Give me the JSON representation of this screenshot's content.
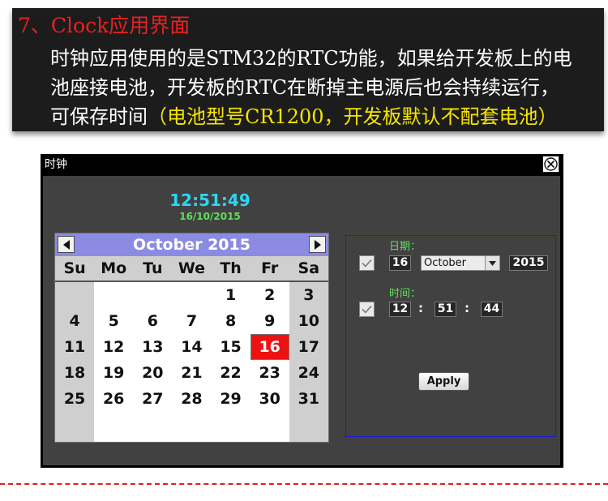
{
  "banner": {
    "title": "7、Clock应用界面",
    "line1": "时钟应用使用的是STM32的RTC功能，如果给开发板上的电",
    "line2": "池座接电池，开发板的RTC在断掉主电源后也会持续运行，",
    "line3_plain": "可保存时间",
    "line3_highlight": "（电池型号CR1200，开发板默认不配套电池）"
  },
  "window": {
    "title": "时钟",
    "close_icon": "close-x-icon"
  },
  "clock": {
    "time": "12:51:49",
    "date": "16/10/2015"
  },
  "calendar": {
    "month_label": "October 2015",
    "prev_icon": "left-triangle-icon",
    "next_icon": "right-triangle-icon",
    "weekdays": [
      "Su",
      "Mo",
      "Tu",
      "We",
      "Th",
      "Fr",
      "Sa"
    ],
    "days": [
      "1",
      "2",
      "3",
      "4",
      "5",
      "6",
      "7",
      "8",
      "9",
      "10",
      "11",
      "12",
      "13",
      "14",
      "15",
      "16",
      "17",
      "18",
      "19",
      "20",
      "21",
      "22",
      "23",
      "24",
      "25",
      "26",
      "27",
      "28",
      "29",
      "30",
      "31"
    ],
    "selected_day": "16",
    "colors": {
      "header": "#8b8be4",
      "selected": "#ee1111",
      "weekend": "#cfcfcf"
    }
  },
  "settings": {
    "date_label": "日期：",
    "time_label": "时间：",
    "day": "16",
    "month": "October",
    "year": "2015",
    "hour": "12",
    "minute": "51",
    "second": "44",
    "separator": ":",
    "apply_label": "Apply"
  }
}
